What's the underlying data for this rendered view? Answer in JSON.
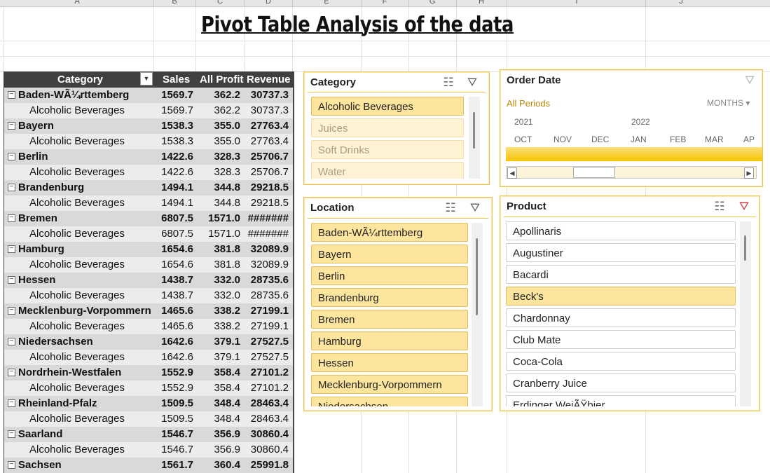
{
  "sheet": {
    "columns": [
      "A",
      "B",
      "C",
      "D",
      "E",
      "F",
      "G",
      "H",
      "I",
      "J"
    ],
    "title": "Pivot Table Analysis of the data"
  },
  "pivot": {
    "headers": [
      "Category",
      "Sales",
      "All Profit",
      "Revenue"
    ],
    "groups": [
      {
        "name": "Baden-WÃ¼rttemberg",
        "sales": "1569.7",
        "profit": "362.2",
        "revenue": "30737.3",
        "child": "Alcoholic Beverages",
        "c_sales": "1569.7",
        "c_profit": "362.2",
        "c_revenue": "30737.3"
      },
      {
        "name": "Bayern",
        "sales": "1538.3",
        "profit": "355.0",
        "revenue": "27763.4",
        "child": "Alcoholic Beverages",
        "c_sales": "1538.3",
        "c_profit": "355.0",
        "c_revenue": "27763.4"
      },
      {
        "name": "Berlin",
        "sales": "1422.6",
        "profit": "328.3",
        "revenue": "25706.7",
        "child": "Alcoholic Beverages",
        "c_sales": "1422.6",
        "c_profit": "328.3",
        "c_revenue": "25706.7"
      },
      {
        "name": "Brandenburg",
        "sales": "1494.1",
        "profit": "344.8",
        "revenue": "29218.5",
        "child": "Alcoholic Beverages",
        "c_sales": "1494.1",
        "c_profit": "344.8",
        "c_revenue": "29218.5"
      },
      {
        "name": "Bremen",
        "sales": "6807.5",
        "profit": "1571.0",
        "revenue": "#######",
        "child": "Alcoholic Beverages",
        "c_sales": "6807.5",
        "c_profit": "1571.0",
        "c_revenue": "#######"
      },
      {
        "name": "Hamburg",
        "sales": "1654.6",
        "profit": "381.8",
        "revenue": "32089.9",
        "child": "Alcoholic Beverages",
        "c_sales": "1654.6",
        "c_profit": "381.8",
        "c_revenue": "32089.9"
      },
      {
        "name": "Hessen",
        "sales": "1438.7",
        "profit": "332.0",
        "revenue": "28735.6",
        "child": "Alcoholic Beverages",
        "c_sales": "1438.7",
        "c_profit": "332.0",
        "c_revenue": "28735.6"
      },
      {
        "name": "Mecklenburg-Vorpommern",
        "sales": "1465.6",
        "profit": "338.2",
        "revenue": "27199.1",
        "child": "Alcoholic Beverages",
        "c_sales": "1465.6",
        "c_profit": "338.2",
        "c_revenue": "27199.1"
      },
      {
        "name": "Niedersachsen",
        "sales": "1642.6",
        "profit": "379.1",
        "revenue": "27527.5",
        "child": "Alcoholic Beverages",
        "c_sales": "1642.6",
        "c_profit": "379.1",
        "c_revenue": "27527.5"
      },
      {
        "name": "Nordrhein-Westfalen",
        "sales": "1552.9",
        "profit": "358.4",
        "revenue": "27101.2",
        "child": "Alcoholic Beverages",
        "c_sales": "1552.9",
        "c_profit": "358.4",
        "c_revenue": "27101.2"
      },
      {
        "name": "Rheinland-Pfalz",
        "sales": "1509.5",
        "profit": "348.4",
        "revenue": "28463.4",
        "child": "Alcoholic Beverages",
        "c_sales": "1509.5",
        "c_profit": "348.4",
        "c_revenue": "28463.4"
      },
      {
        "name": "Saarland",
        "sales": "1546.7",
        "profit": "356.9",
        "revenue": "30860.4",
        "child": "Alcoholic Beverages",
        "c_sales": "1546.7",
        "c_profit": "356.9",
        "c_revenue": "30860.4"
      },
      {
        "name": "Sachsen",
        "sales": "1561.7",
        "profit": "360.4",
        "revenue": "25991.8"
      }
    ]
  },
  "slicers": {
    "category": {
      "title": "Category",
      "items": [
        {
          "label": "Alcoholic Beverages",
          "state": "sel"
        },
        {
          "label": "Juices",
          "state": "dim"
        },
        {
          "label": "Soft Drinks",
          "state": "dim"
        },
        {
          "label": "Water",
          "state": "dim"
        }
      ]
    },
    "location": {
      "title": "Location",
      "items": [
        {
          "label": "Baden-WÃ¼rttemberg",
          "state": "sel"
        },
        {
          "label": "Bayern",
          "state": "sel"
        },
        {
          "label": "Berlin",
          "state": "sel"
        },
        {
          "label": "Brandenburg",
          "state": "sel"
        },
        {
          "label": "Bremen",
          "state": "sel"
        },
        {
          "label": "Hamburg",
          "state": "sel"
        },
        {
          "label": "Hessen",
          "state": "sel"
        },
        {
          "label": "Mecklenburg-Vorpommern",
          "state": "sel"
        },
        {
          "label": "Niedersachsen",
          "state": "sel"
        }
      ]
    },
    "product": {
      "title": "Product",
      "items": [
        {
          "label": "Apollinaris",
          "state": "plain"
        },
        {
          "label": "Augustiner",
          "state": "plain"
        },
        {
          "label": "Bacardi",
          "state": "plain"
        },
        {
          "label": "Beck's",
          "state": "sel"
        },
        {
          "label": "Chardonnay",
          "state": "plain"
        },
        {
          "label": "Club Mate",
          "state": "plain"
        },
        {
          "label": "Coca-Cola",
          "state": "plain"
        },
        {
          "label": "Cranberry Juice",
          "state": "plain"
        },
        {
          "label": "Erdinger WeiÃŸbier",
          "state": "plain"
        }
      ]
    },
    "timeline": {
      "title": "Order Date",
      "all_periods": "All Periods",
      "level": "MONTHS",
      "years": [
        "2021",
        "2022"
      ],
      "months": [
        "OCT",
        "NOV",
        "DEC",
        "JAN",
        "FEB",
        "MAR",
        "AP"
      ]
    }
  },
  "icons": {
    "multiselect": "multi-select-icon",
    "clear_filter": "clear-filter-icon",
    "collapse": "collapse-icon",
    "dropdown": "dropdown-arrow-icon"
  },
  "colors": {
    "accent": "#f0c14b",
    "selected_item": "#fde59e",
    "header_dark": "#404040",
    "group_row": "#d9d9d9"
  }
}
